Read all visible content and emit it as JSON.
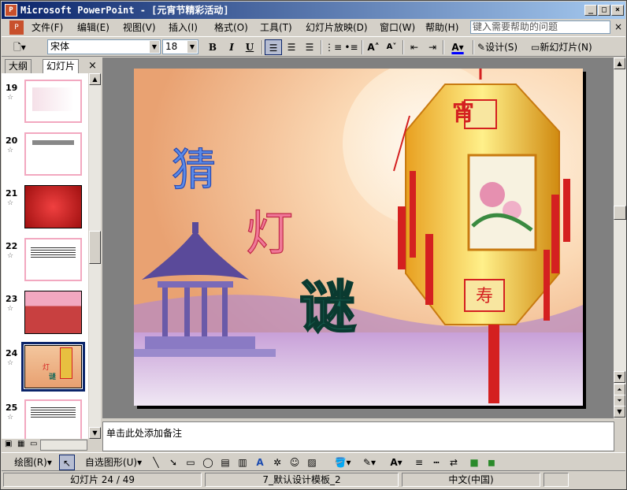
{
  "window": {
    "title": "Microsoft PowerPoint - [元宵节精彩活动]"
  },
  "menu": {
    "items": [
      "文件(F)",
      "编辑(E)",
      "视图(V)",
      "插入(I)",
      "格式(O)",
      "工具(T)",
      "幻灯片放映(D)",
      "窗口(W)",
      "帮助(H)"
    ],
    "help_placeholder": "键入需要帮助的问题"
  },
  "toolbar": {
    "font": "宋体",
    "size": "18",
    "bold": "B",
    "italic": "I",
    "underline": "U",
    "design_label": "设计(S)",
    "new_slide_label": "新幻灯片(N)"
  },
  "leftpane": {
    "tabs": [
      "大纲",
      "幻灯片"
    ],
    "slides": [
      {
        "num": "19"
      },
      {
        "num": "20"
      },
      {
        "num": "21"
      },
      {
        "num": "22"
      },
      {
        "num": "23"
      },
      {
        "num": "24"
      },
      {
        "num": "25"
      }
    ]
  },
  "slide": {
    "char1": "猜",
    "char2": "灯",
    "char3": "谜",
    "lantern_top": "宵",
    "lantern_bottom": "寿"
  },
  "notes": {
    "placeholder": "单击此处添加备注"
  },
  "drawbar": {
    "draw_label": "绘图(R)",
    "autoshape_label": "自选图形(U)"
  },
  "status": {
    "slide": "幻灯片 24 / 49",
    "template": "7_默认设计模板_2",
    "language": "中文(中国)"
  },
  "colors": {
    "title_start": "#0a246a",
    "title_end": "#a6caf0",
    "slide_bg": "#f3c69d",
    "lantern_red": "#d42020"
  }
}
